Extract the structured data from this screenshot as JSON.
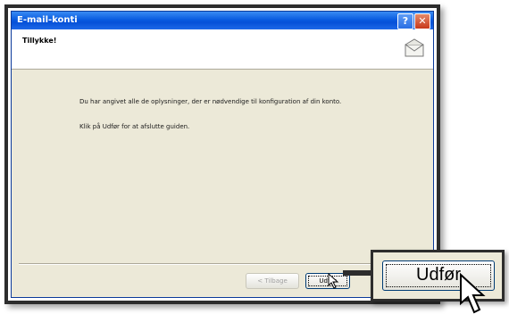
{
  "window": {
    "title": "E-mail-konti",
    "help_glyph": "?",
    "close_glyph": "✕"
  },
  "header": {
    "title": "Tillykke!",
    "icon": "envelope-icon"
  },
  "body": {
    "line1": "Du har angivet alle de oplysninger, der er nødvendige til konfiguration af din konto.",
    "line2": "Klik på Udfør for at afslutte guiden."
  },
  "buttons": {
    "back_label": "< Tilbage",
    "finish_label": "Udfør"
  },
  "callout": {
    "label": "Udfør"
  },
  "colors": {
    "titlebar": "#0a5ce0",
    "frame": "#2d2d2d",
    "dialog_bg": "#ece9d8"
  }
}
